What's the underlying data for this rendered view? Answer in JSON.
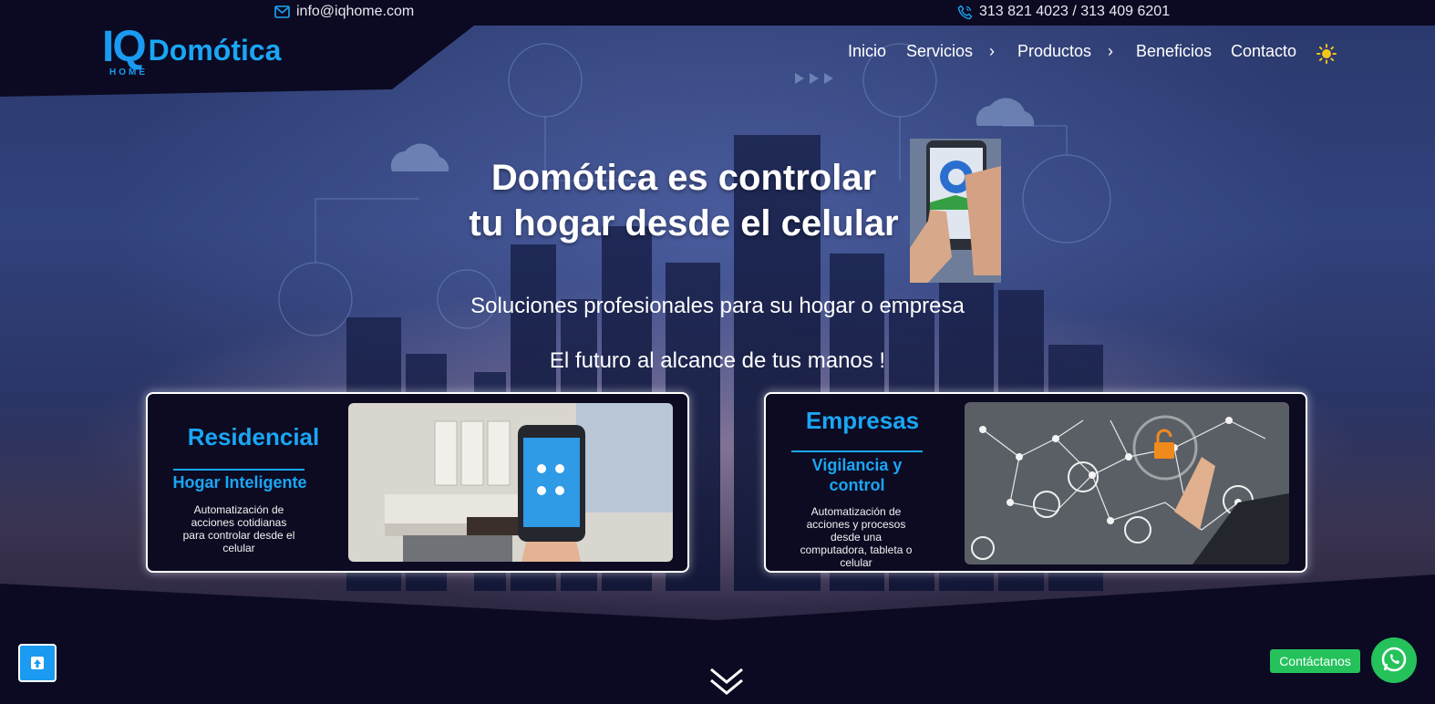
{
  "topbar": {
    "email": "info@iqhome.com",
    "phone": "313 821 4023 / 313 409 6201"
  },
  "logo": {
    "mark": "IQ",
    "mark_sub": "HOME",
    "name": "Domótica"
  },
  "nav": {
    "items": [
      "Inicio",
      "Servicios",
      "Productos",
      "Beneficios",
      "Contacto"
    ],
    "has_submenu": [
      "Servicios",
      "Productos"
    ],
    "theme_toggle_icon": "sun-icon"
  },
  "hero": {
    "headline_line1": "Domótica es controlar",
    "headline_line2": "tu hogar desde el celular",
    "subtitle": "Soluciones profesionales para su hogar o empresa",
    "tagline": "El futuro al alcance de tus manos !"
  },
  "cards": [
    {
      "title": "Residencial",
      "subtitle": "Hogar Inteligente",
      "description": "Automatización de acciones cotidianas para controlar desde el celular",
      "image": "living-room-smartphone-image"
    },
    {
      "title": "Empresas",
      "subtitle": "Vigilancia y control",
      "description": "Automatización de acciones y procesos desde una computadora, tableta o celular",
      "image": "network-security-image"
    }
  ],
  "floating": {
    "scroll_top_icon": "arrow-up-icon",
    "contact_label": "Contáctanos",
    "whatsapp_icon": "whatsapp-icon",
    "scroll_down_icon": "double-chevron-down-icon"
  },
  "colors": {
    "brand_blue": "#1aa6f4",
    "dark_navy": "#0b0a22",
    "whatsapp_green": "#25c25c",
    "sun_yellow": "#f5c518"
  }
}
